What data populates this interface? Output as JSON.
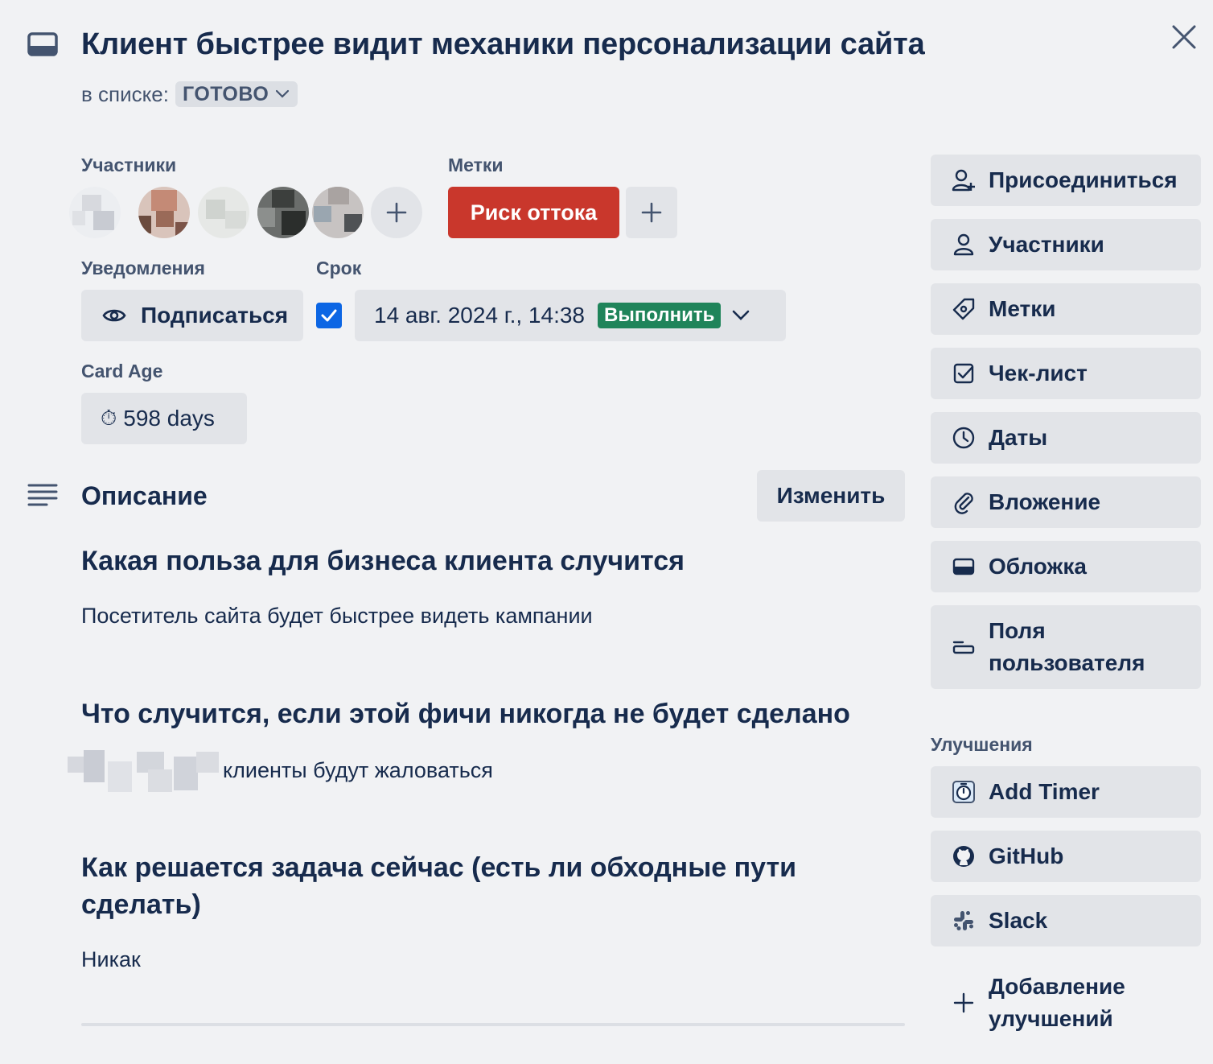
{
  "card": {
    "title": "Клиент быстрее видит механики персонализации сайта",
    "list_prefix": "в списке:",
    "list_name": "ГОТОВО"
  },
  "members": {
    "label": "Участники",
    "count_avatars": 5
  },
  "labels": {
    "label": "Метки",
    "items": [
      {
        "text": "Риск оттока",
        "color": "#c9372c"
      }
    ]
  },
  "notifications": {
    "label": "Уведомления",
    "watch_label": "Подписаться"
  },
  "due": {
    "label": "Срок",
    "checked": true,
    "date": "14 авг. 2024 г., 14:38",
    "status": "Выполнить",
    "status_color": "#1f845a"
  },
  "card_age": {
    "label": "Card Age",
    "value": "598 days"
  },
  "description": {
    "title": "Описание",
    "edit_label": "Изменить",
    "blocks": [
      {
        "heading": "Какая польза для бизнеса клиента случится",
        "text": "Посетитель сайта будет быстрее видеть кампании"
      },
      {
        "heading": "Что случится, если этой фичи никогда не будет сделано",
        "text": "клиенты будут жаловаться"
      },
      {
        "heading": "Как решается задача сейчас (есть ли обходные пути сделать)",
        "text": "Никак"
      }
    ]
  },
  "sidebar": {
    "buttons": [
      {
        "label": "Присоединиться",
        "icon": "add-person-icon"
      },
      {
        "label": "Участники",
        "icon": "person-icon"
      },
      {
        "label": "Метки",
        "icon": "tag-icon"
      },
      {
        "label": "Чек-лист",
        "icon": "checklist-icon"
      },
      {
        "label": "Даты",
        "icon": "clock-icon"
      },
      {
        "label": "Вложение",
        "icon": "paperclip-icon"
      },
      {
        "label": "Обложка",
        "icon": "cover-icon"
      },
      {
        "label": "Поля пользователя",
        "icon": "custom-fields-icon"
      }
    ],
    "powerups_label": "Улучшения",
    "powerups": [
      {
        "label": "Add Timer",
        "icon": "timer-icon"
      },
      {
        "label": "GitHub",
        "icon": "github-icon"
      },
      {
        "label": "Slack",
        "icon": "slack-icon"
      }
    ],
    "add_powerups_label": "Добавление улучшений"
  }
}
